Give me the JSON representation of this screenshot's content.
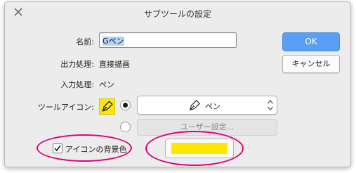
{
  "window": {
    "title": "サブツールの設定",
    "close_icon": "close-icon"
  },
  "fields": {
    "name_label": "名前:",
    "name_value": "Gペン",
    "output_label": "出力処理:",
    "output_value": "直接描画",
    "input_label": "入力処理:",
    "input_value": "ペン",
    "tool_icon_label": "ツールアイコン:",
    "tool_icon_color": "#ffe800"
  },
  "buttons": {
    "ok": "OK",
    "cancel": "キャンセル"
  },
  "icon_select": {
    "selected": "ペン",
    "icon": "pen-nib-icon"
  },
  "user_setting": "ユーザー設定...",
  "background": {
    "checkbox_label": "アイコンの背景色",
    "checked": true,
    "color": "#ffe600"
  },
  "colors": {
    "accent": "#5a9ff5",
    "highlight": "#e1007c"
  }
}
